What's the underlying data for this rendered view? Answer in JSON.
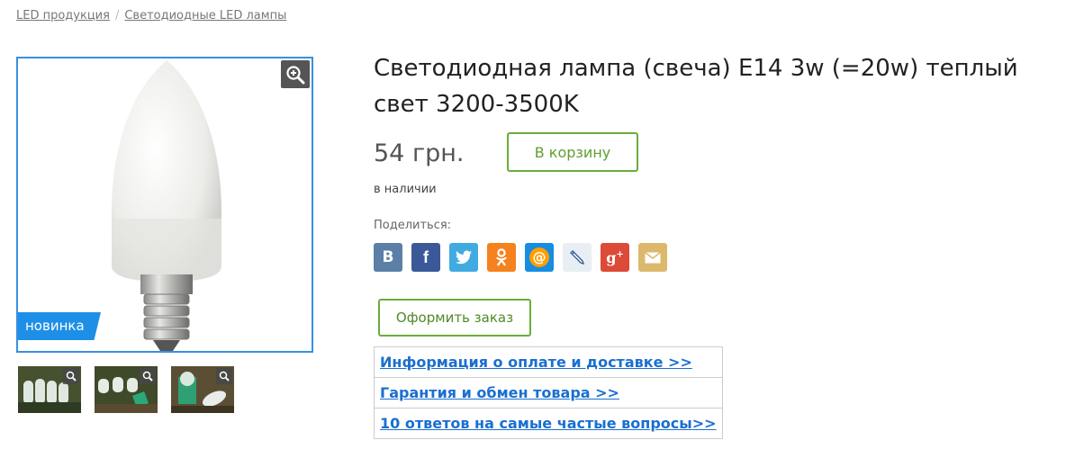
{
  "breadcrumb": {
    "items": [
      "LED продукция",
      "Светодиодные LED лампы"
    ],
    "separator": "/"
  },
  "product": {
    "title": "Светодиодная лампа (свеча) E14 3w (=20w) теплый свет 3200-3500K",
    "price": "54 грн.",
    "cart_button": "В корзину",
    "stock_status": "в наличии",
    "badge": "новинка",
    "order_button": "Оформить заказ"
  },
  "share": {
    "label": "Поделиться:",
    "networks": [
      {
        "name": "vkontakte",
        "glyph": "B",
        "color": "#5b7fa6"
      },
      {
        "name": "facebook",
        "glyph": "f",
        "color": "#3b5998"
      },
      {
        "name": "twitter",
        "glyph": "twitter-bird",
        "color": "#41abe1"
      },
      {
        "name": "odnoklassniki",
        "glyph": "ok",
        "color": "#f5821f"
      },
      {
        "name": "moimir",
        "glyph": "@",
        "color": "#168de2"
      },
      {
        "name": "livejournal",
        "glyph": "pencil",
        "color": "#e8eef4"
      },
      {
        "name": "googleplus",
        "glyph": "g+",
        "color": "#dc4a38"
      },
      {
        "name": "email",
        "glyph": "envelope",
        "color": "#dcb86c"
      }
    ]
  },
  "info_links": [
    "Информация о оплате и доставке >>",
    "Гарантия и обмен товара >>",
    "10 ответов на самые частые вопросы>>"
  ],
  "colors": {
    "accent_blue": "#1e8fe6",
    "button_green": "#6aad3a",
    "link_blue": "#1a6fd0"
  }
}
